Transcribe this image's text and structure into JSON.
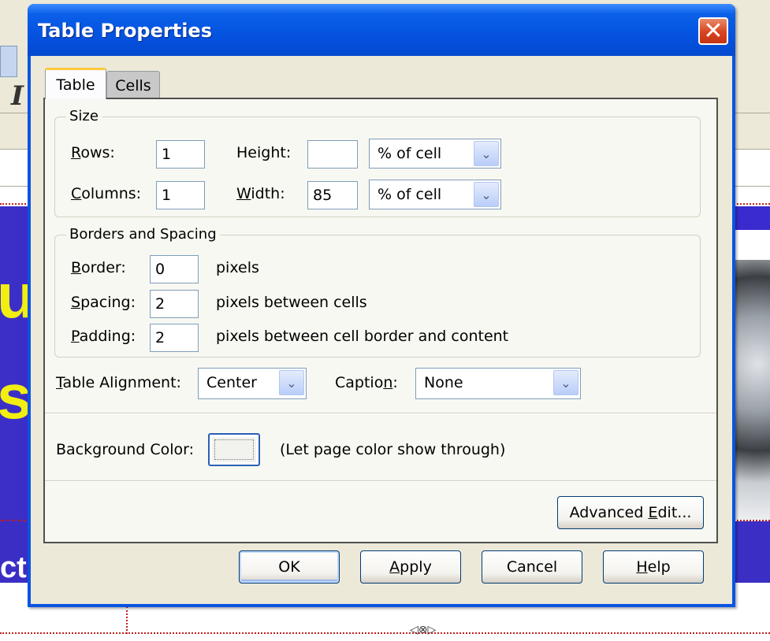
{
  "dialog": {
    "title": "Table Properties",
    "close_glyph": "✕"
  },
  "tabs": [
    {
      "label": "Table",
      "active": true
    },
    {
      "label": "Cells",
      "active": false
    }
  ],
  "size_group": {
    "title": "Size",
    "rows_label_key": "R",
    "rows_label_rest": "ows:",
    "rows_value": "1",
    "columns_label_key": "C",
    "columns_label_rest": "olumns:",
    "columns_value": "1",
    "height_label_pre": "Hei",
    "height_label_key": "g",
    "height_label_rest": "ht:",
    "height_value": "",
    "height_unit": "% of cell",
    "width_label_key": "W",
    "width_label_rest": "idth:",
    "width_value": "85",
    "width_unit": "% of cell"
  },
  "borders_group": {
    "title": "Borders and Spacing",
    "border_label_key": "B",
    "border_label_rest": "order:",
    "border_value": "0",
    "border_unit": "pixels",
    "spacing_label_key": "S",
    "spacing_label_rest": "pacing:",
    "spacing_value": "2",
    "spacing_unit": "pixels between cells",
    "padding_label_key": "P",
    "padding_label_rest": "adding:",
    "padding_value": "2",
    "padding_unit": "pixels between cell border and content"
  },
  "alignment": {
    "label_key": "T",
    "label_rest": "able Alignment:",
    "value": "Center",
    "caption_label_pre": "Captio",
    "caption_label_key": "n",
    "caption_label_rest": ":",
    "caption_value": "None"
  },
  "background": {
    "label": "Background Color:",
    "hint": "(Let page color show through)"
  },
  "advanced_button": {
    "pre": "Advanced ",
    "key": "E",
    "rest": "dit..."
  },
  "buttons": {
    "ok": "OK",
    "apply_key": "A",
    "apply_rest": "pply",
    "cancel": "Cancel",
    "help_key": "H",
    "help_rest": "elp"
  },
  "dropdown_arrow_glyph": "⌄",
  "background_page": {
    "italic_glyph": "I",
    "banner_letters": [
      "u",
      "s"
    ],
    "footer_fragment": "ct",
    "anchor_glyph": "◁⊗▷"
  },
  "colors": {
    "title_bar": "#0553e0",
    "dialog_face": "#ece9d8",
    "banner": "#3b2fc8",
    "close_button": "#d8431e"
  }
}
